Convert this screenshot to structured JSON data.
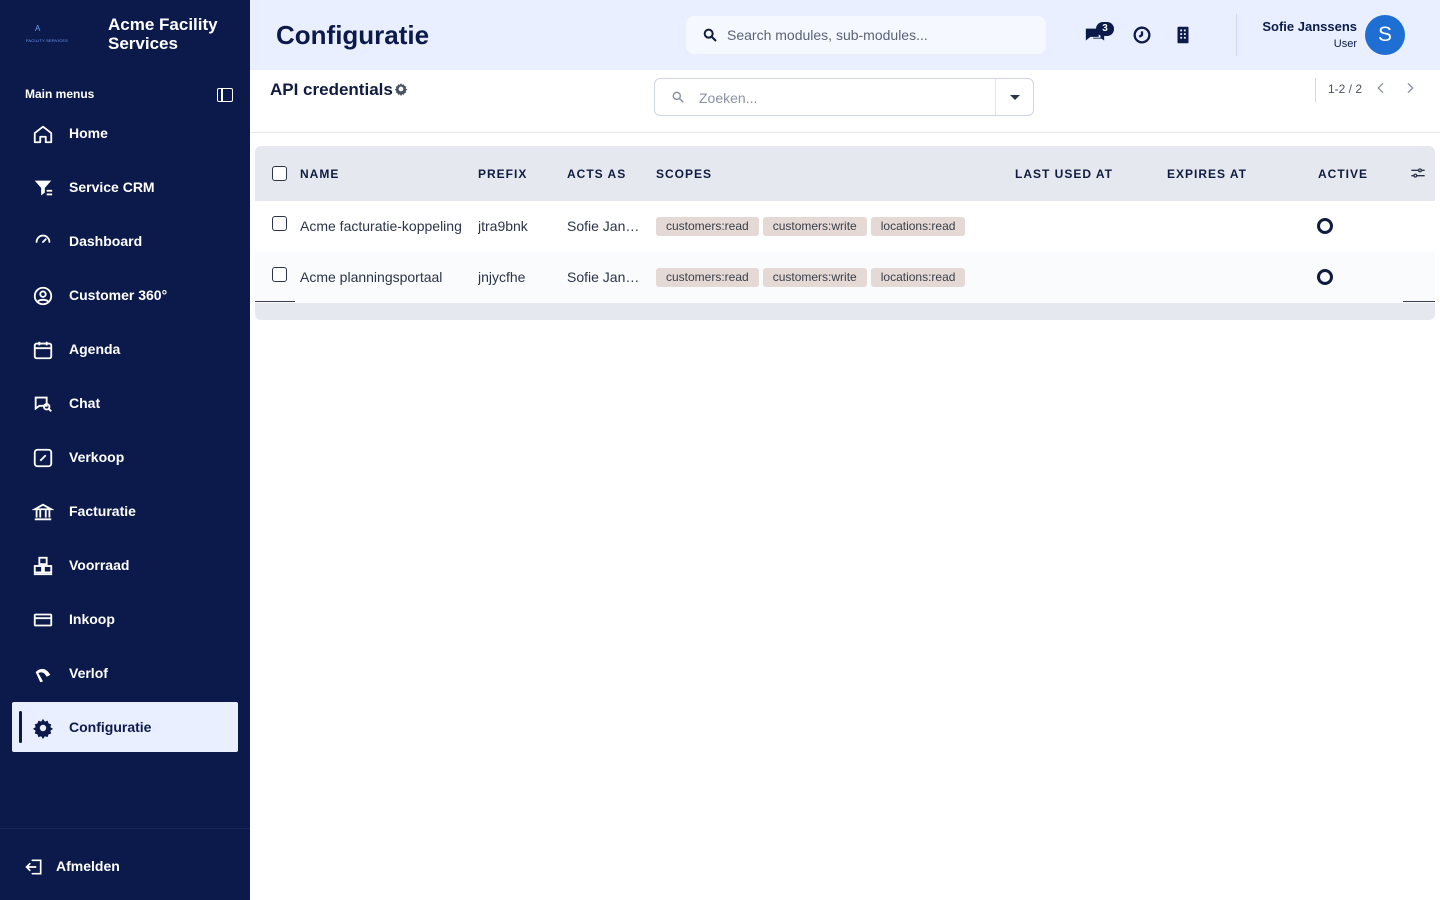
{
  "brand": {
    "logo_letter": "A",
    "logo_subtext": "FACILITY SERVICES",
    "name": "Acme Facility Services"
  },
  "sidebar": {
    "section_label": "Main menus",
    "items": [
      {
        "label": "Home",
        "icon": "home-icon"
      },
      {
        "label": "Service CRM",
        "icon": "filter-icon"
      },
      {
        "label": "Dashboard",
        "icon": "gauge-icon"
      },
      {
        "label": "Customer 360°",
        "icon": "user-circle-icon"
      },
      {
        "label": "Agenda",
        "icon": "calendar-icon"
      },
      {
        "label": "Chat",
        "icon": "chat-search-icon"
      },
      {
        "label": "Verkoop",
        "icon": "percent-icon"
      },
      {
        "label": "Facturatie",
        "icon": "bank-icon"
      },
      {
        "label": "Voorraad",
        "icon": "warehouse-icon"
      },
      {
        "label": "Inkoop",
        "icon": "card-icon"
      },
      {
        "label": "Verlof",
        "icon": "plane-icon"
      },
      {
        "label": "Configuratie",
        "icon": "gear-icon",
        "active": true
      }
    ],
    "logout_label": "Afmelden"
  },
  "header": {
    "title": "Configuratie",
    "search_placeholder": "Search modules, sub-modules...",
    "chat_badge": "3",
    "user_name": "Sofie Janssens",
    "user_role": "User",
    "avatar_initial": "S",
    "accent": "#0c1a4b",
    "avatar_color": "#1f6ed4"
  },
  "content": {
    "title": "API credentials",
    "filter_placeholder": "Zoeken...",
    "pager": "1-2 / 2"
  },
  "table": {
    "columns": [
      "NAME",
      "PREFIX",
      "ACTS AS",
      "SCOPES",
      "LAST USED AT",
      "EXPIRES AT",
      "ACTIVE"
    ],
    "rows": [
      {
        "name": "Acme facturatie-koppeling",
        "prefix": "jtra9bnk",
        "acts_as": "Sofie Janssens",
        "scopes": [
          "customers:read",
          "customers:write",
          "locations:read"
        ],
        "last_used_at": "",
        "expires_at": "",
        "active": false
      },
      {
        "name": "Acme planningsportaal",
        "prefix": "jnjycfhe",
        "acts_as": "Sofie Janssens",
        "scopes": [
          "customers:read",
          "customers:write",
          "locations:read"
        ],
        "last_used_at": "",
        "expires_at": "",
        "active": false
      }
    ]
  }
}
